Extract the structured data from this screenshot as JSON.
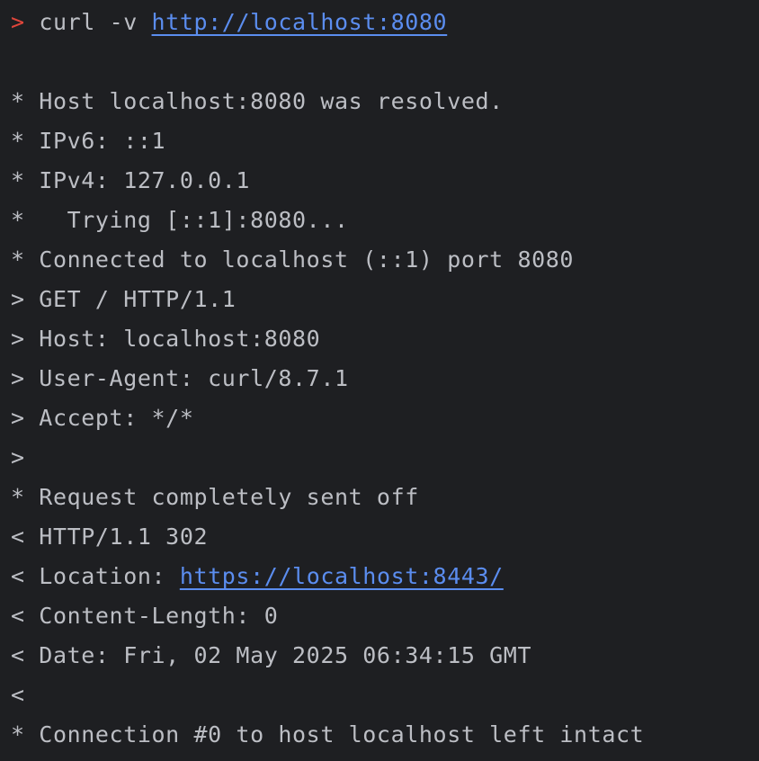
{
  "terminal": {
    "colors": {
      "background": "#1e1f22",
      "text": "#bcbec4",
      "prompt": "#e0463b",
      "link": "#5b8def"
    },
    "command": {
      "prompt": ">",
      "text": "curl -v ",
      "url": "http://localhost:8080"
    },
    "lines": [
      {
        "id": "blank",
        "text": ""
      },
      {
        "id": "host-resolved",
        "text": "* Host localhost:8080 was resolved."
      },
      {
        "id": "ipv6",
        "text": "* IPv6: ::1"
      },
      {
        "id": "ipv4",
        "text": "* IPv4: 127.0.0.1"
      },
      {
        "id": "trying",
        "text": "*   Trying [::1]:8080..."
      },
      {
        "id": "connected",
        "text": "* Connected to localhost (::1) port 8080"
      },
      {
        "id": "req-get",
        "text": "> GET / HTTP/1.1"
      },
      {
        "id": "req-host",
        "text": "> Host: localhost:8080"
      },
      {
        "id": "req-user-agent",
        "text": "> User-Agent: curl/8.7.1"
      },
      {
        "id": "req-accept",
        "text": "> Accept: */*"
      },
      {
        "id": "req-end",
        "text": ">"
      },
      {
        "id": "request-sent",
        "text": "* Request completely sent off"
      },
      {
        "id": "resp-status",
        "text": "< HTTP/1.1 302"
      },
      {
        "id": "resp-location",
        "prefix": "< Location: ",
        "url": "https://localhost:8443/"
      },
      {
        "id": "resp-content-length",
        "text": "< Content-Length: 0"
      },
      {
        "id": "resp-date",
        "text": "< Date: Fri, 02 May 2025 06:34:15 GMT"
      },
      {
        "id": "resp-end",
        "text": "<"
      },
      {
        "id": "conn-intact",
        "text": "* Connection #0 to host localhost left intact"
      }
    ]
  }
}
